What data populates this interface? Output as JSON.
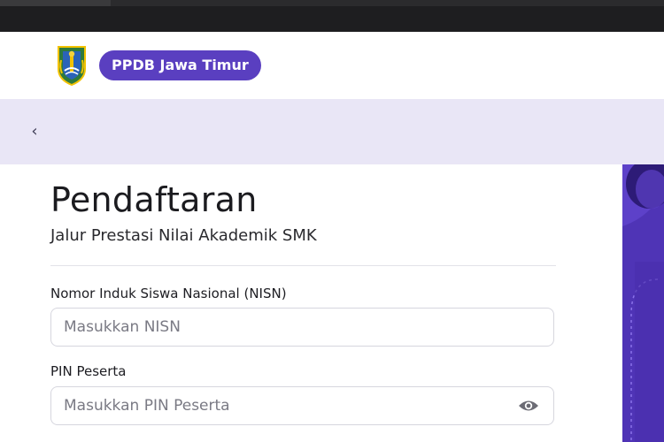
{
  "header": {
    "brand": "PPDB Jawa Timur",
    "logo_icon": "east-java-emblem-icon"
  },
  "subnav": {
    "back_icon": "‹"
  },
  "form": {
    "title": "Pendaftaran",
    "subtitle": "Jalur Prestasi Nilai Akademik SMK",
    "nisn": {
      "label": "Nomor Induk Siswa Nasional (NISN)",
      "placeholder": "Masukkan NISN",
      "value": ""
    },
    "pin": {
      "label": "PIN Peserta",
      "placeholder": "Masukkan PIN Peserta",
      "value": "",
      "toggle_icon": "eye-icon"
    }
  },
  "colors": {
    "brand": "#5a3fc0",
    "subnav_bg": "#e9e6f6",
    "side_panel": "#4f34b6",
    "topbar": "#1e1e20"
  }
}
